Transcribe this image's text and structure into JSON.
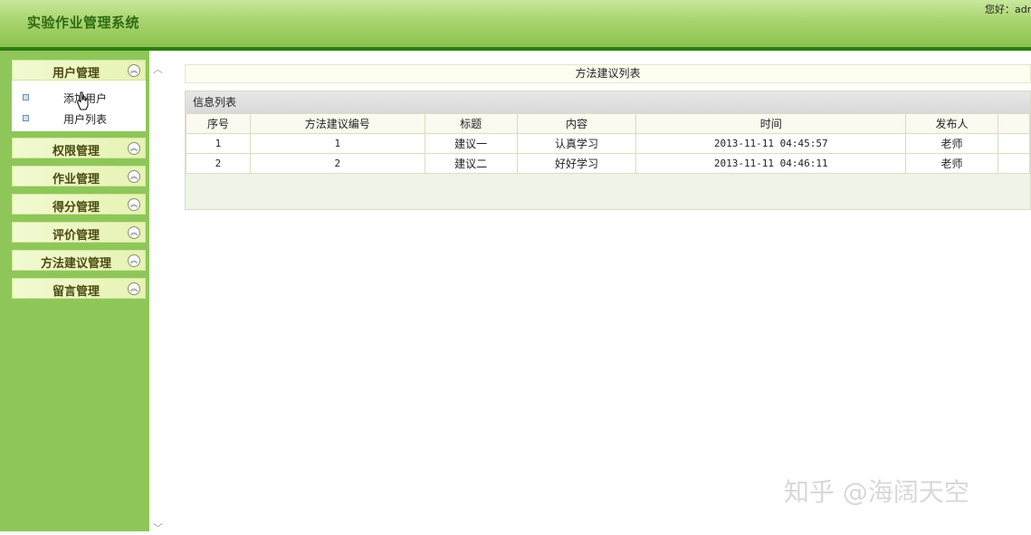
{
  "header": {
    "app_title": "实验作业管理系统",
    "greeting": "您好：admin"
  },
  "sidebar": {
    "menus": [
      {
        "label": "用户管理"
      },
      {
        "label": "权限管理"
      },
      {
        "label": "作业管理"
      },
      {
        "label": "得分管理"
      },
      {
        "label": "评价管理"
      },
      {
        "label": "方法建议管理"
      },
      {
        "label": "留言管理"
      }
    ],
    "submenu": [
      {
        "label": "添加用户"
      },
      {
        "label": "用户列表"
      }
    ]
  },
  "main": {
    "panel_title": "方法建议列表",
    "list_header": "信息列表",
    "columns": [
      "序号",
      "方法建议编号",
      "标题",
      "内容",
      "时间",
      "发布人",
      ""
    ],
    "rows": [
      [
        "1",
        "1",
        "建议一",
        "认真学习",
        "2013-11-11 04:45:57",
        "老师",
        ""
      ],
      [
        "2",
        "2",
        "建议二",
        "好好学习",
        "2013-11-11 04:46:11",
        "老师",
        ""
      ]
    ]
  },
  "watermark": "知乎 @海阔天空",
  "icons": {
    "chevron": "chevron-up-icon",
    "cursor": "hand-cursor-icon"
  },
  "colors": {
    "sidebar": "#8fc65a",
    "header_border": "#2f7d12",
    "title": "#2e6a12"
  }
}
